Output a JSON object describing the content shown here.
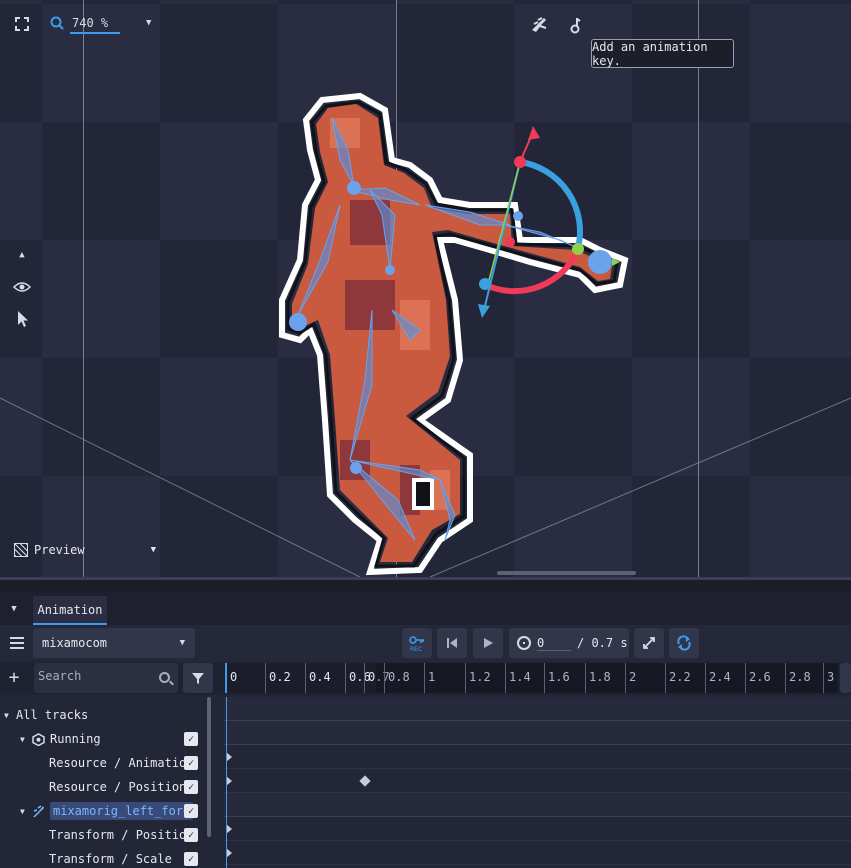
{
  "viewport": {
    "zoom_value": "740 %",
    "tooltip": "Add an animation key.",
    "preview_label": "Preview",
    "icons": [
      "crosshair-icon",
      "zoom-icon",
      "chevron-down-icon",
      "bone-insert-icon",
      "ik-icon",
      "arrow-up-icon",
      "eye-icon",
      "pointer-icon"
    ]
  },
  "panel": {
    "tab_label": "Animation",
    "animation_name": "mixamocom",
    "current_time": "0",
    "length_label": "/ 0.7 s",
    "search_placeholder": "Search",
    "ruler": {
      "labels": [
        "0",
        "0.2",
        "0.4",
        "0.6",
        "0.7",
        "0.8",
        "1",
        "1.2",
        "1.4",
        "1.6",
        "1.8",
        "2",
        "2.2",
        "2.4",
        "2.6",
        "2.8",
        "3"
      ]
    },
    "tracks": [
      {
        "label": "All tracks",
        "checked": false
      },
      {
        "label": "Running",
        "checked": true
      },
      {
        "label": "Resource / Animatio",
        "checked": true
      },
      {
        "label": "Resource / Position",
        "checked": true
      },
      {
        "label": "mixamorig_left_fore",
        "checked": true
      },
      {
        "label": "Transform / Positio",
        "checked": true
      },
      {
        "label": "Transform / Scale",
        "checked": true
      }
    ]
  },
  "colors": {
    "accent": "#3d9cf0",
    "gizmo_x": "#ef3b58",
    "gizmo_y": "#8fd14f",
    "gizmo_z": "#3aa0e0",
    "sprite": "#c95a40"
  }
}
